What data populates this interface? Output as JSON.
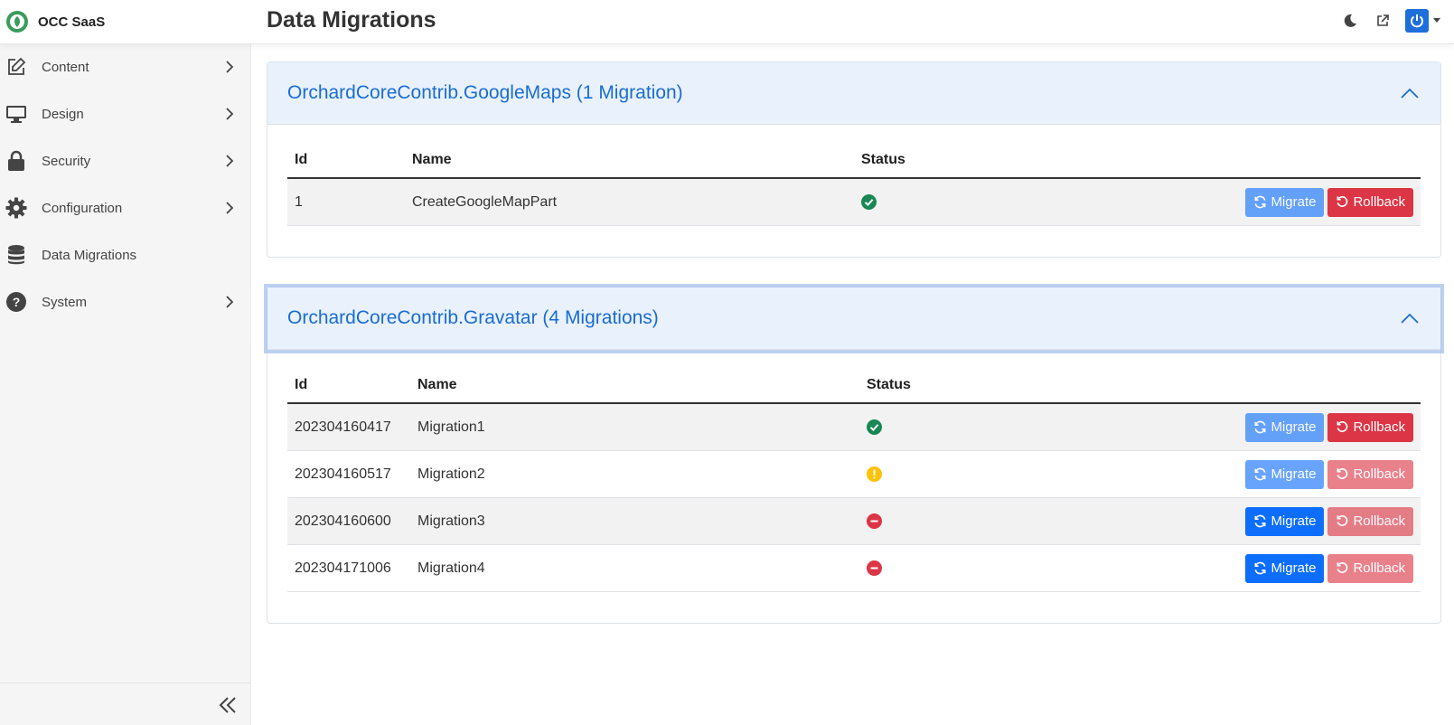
{
  "app": {
    "name": "OCC SaaS",
    "page_title": "Data Migrations"
  },
  "header_icons": [
    "moon-icon",
    "external-link-icon",
    "power-icon",
    "caret-down-icon"
  ],
  "sidebar": {
    "items": [
      {
        "label": "Content",
        "icon": "edit-icon",
        "has_children": true
      },
      {
        "label": "Design",
        "icon": "monitor-icon",
        "has_children": true
      },
      {
        "label": "Security",
        "icon": "lock-icon",
        "has_children": true
      },
      {
        "label": "Configuration",
        "icon": "gear-icon",
        "has_children": true
      },
      {
        "label": "Data Migrations",
        "icon": "database-icon",
        "has_children": false
      },
      {
        "label": "System",
        "icon": "question-icon",
        "has_children": true
      }
    ]
  },
  "columns": {
    "id": "Id",
    "name": "Name",
    "status": "Status"
  },
  "buttons": {
    "migrate": "Migrate",
    "rollback": "Rollback"
  },
  "modules": [
    {
      "title": "OrchardCoreContrib.GoogleMaps (1 Migration)",
      "rows": [
        {
          "id": "1",
          "name": "CreateGoogleMapPart",
          "status": "success",
          "migrate_enabled": false,
          "rollback_enabled": true
        }
      ]
    },
    {
      "title": "OrchardCoreContrib.Gravatar (4 Migrations)",
      "rows": [
        {
          "id": "202304160417",
          "name": "Migration1",
          "status": "success",
          "migrate_enabled": false,
          "rollback_enabled": true
        },
        {
          "id": "202304160517",
          "name": "Migration2",
          "status": "warning",
          "migrate_enabled": false,
          "rollback_enabled": false
        },
        {
          "id": "202304160600",
          "name": "Migration3",
          "status": "pending",
          "migrate_enabled": true,
          "rollback_enabled": false
        },
        {
          "id": "202304171006",
          "name": "Migration4",
          "status": "pending",
          "migrate_enabled": true,
          "rollback_enabled": false
        }
      ]
    }
  ],
  "colors": {
    "accent": "#0d6efd",
    "danger": "#dc3545",
    "success": "#198754",
    "warning": "#ffc107",
    "header_bg": "#e9f1fd"
  }
}
